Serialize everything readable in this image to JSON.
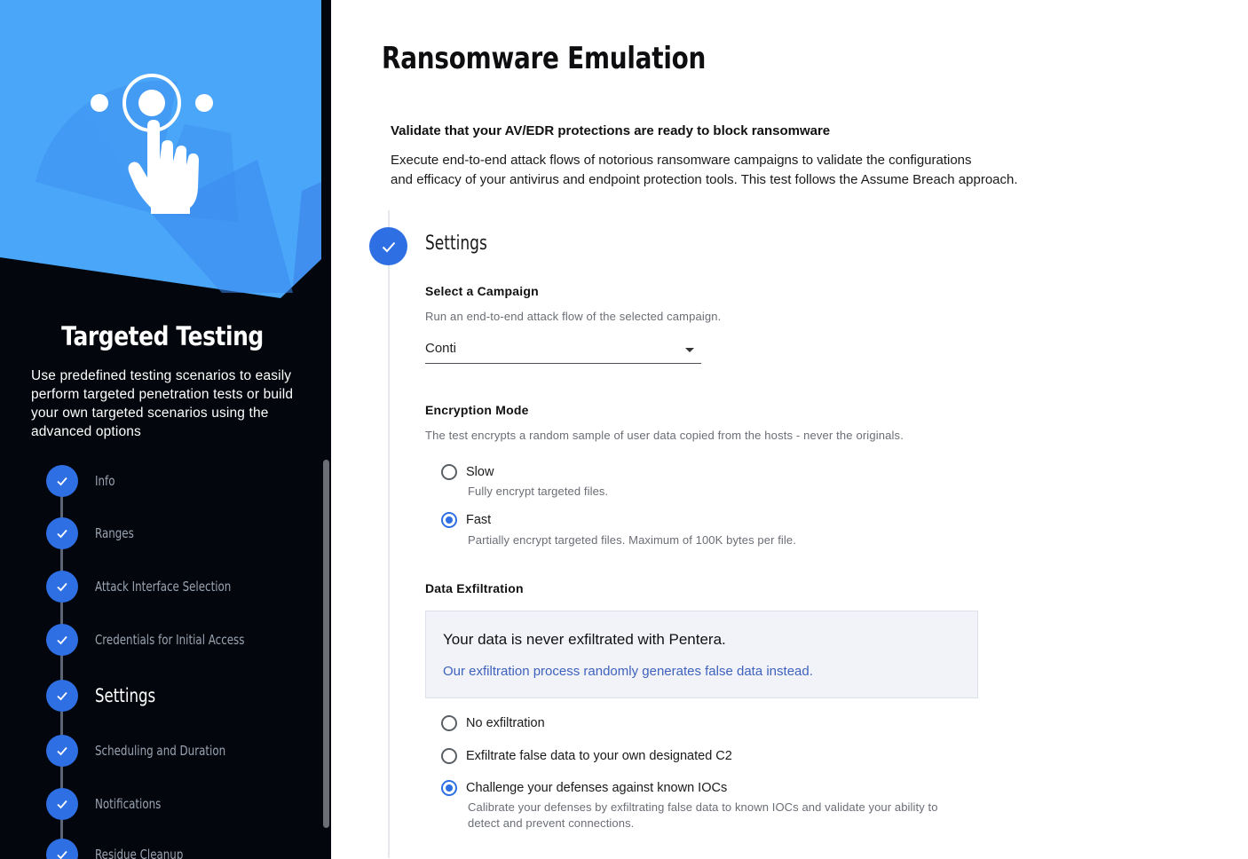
{
  "sidebar": {
    "title": "Targeted Testing",
    "description": "Use predefined testing scenarios to easily perform targeted penetration tests or build your own targeted scenarios using the advanced options",
    "steps": [
      {
        "label": "Info",
        "completed": true,
        "active": false
      },
      {
        "label": "Ranges",
        "completed": true,
        "active": false
      },
      {
        "label": "Attack Interface Selection",
        "completed": true,
        "active": false
      },
      {
        "label": "Credentials for Initial Access",
        "completed": true,
        "active": false
      },
      {
        "label": "Settings",
        "completed": true,
        "active": true
      },
      {
        "label": "Scheduling and Duration",
        "completed": true,
        "active": false
      },
      {
        "label": "Notifications",
        "completed": true,
        "active": false
      },
      {
        "label": "Residue Cleanup",
        "completed": true,
        "active": false
      }
    ]
  },
  "main": {
    "title": "Ransomware Emulation",
    "validate_heading": "Validate that your AV/EDR protections are ready to block ransomware",
    "intro_line1": "Execute end-to-end attack flows of notorious ransomware campaigns to validate the configurations",
    "intro_line2": "and efficacy of your antivirus and endpoint protection tools. This test follows the Assume Breach approach.",
    "section_title": "Settings",
    "campaign": {
      "label": "Select a Campaign",
      "help": "Run an end-to-end attack flow of the selected campaign.",
      "selected": "Conti"
    },
    "encryption": {
      "label": "Encryption Mode",
      "help": "The test encrypts a random sample of user data copied from the hosts - never the originals.",
      "options": [
        {
          "label": "Slow",
          "help": "Fully encrypt targeted files.",
          "checked": false
        },
        {
          "label": "Fast",
          "help": "Partially encrypt targeted files. Maximum of 100K bytes per file.",
          "checked": true
        }
      ]
    },
    "exfiltration": {
      "label": "Data Exfiltration",
      "info_title": "Your data is never exfiltrated with Pentera.",
      "info_link": "Our exfiltration process randomly generates false data instead.",
      "options": [
        {
          "label": "No exfiltration",
          "checked": false
        },
        {
          "label": "Exfiltrate false data to your own designated C2",
          "checked": false
        },
        {
          "label": "Challenge your defenses against known IOCs",
          "checked": true,
          "help_line1": "Calibrate your defenses by exfiltrating false data to known IOCs and validate your ability to",
          "help_line2": "detect and prevent connections."
        }
      ]
    }
  },
  "colors": {
    "accent": "#2f6fe4",
    "sidebar_bg": "#03060c",
    "hero_blue": "#4aa6f8",
    "link": "#3f62bd"
  }
}
